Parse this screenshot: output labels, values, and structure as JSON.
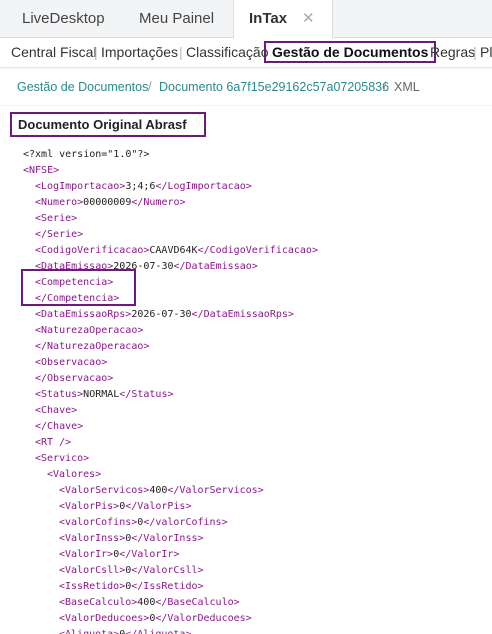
{
  "tabs": [
    {
      "label": "LiveDesktop"
    },
    {
      "label": "Meu Painel"
    },
    {
      "label": "InTax",
      "close": "✕"
    }
  ],
  "submenu": {
    "items": [
      "Central Fiscal",
      "Importações",
      "Classificação",
      "Gestão de Documentos",
      "Regras",
      "Pl"
    ],
    "separator": "|",
    "active_index": 3
  },
  "breadcrumb": {
    "items": [
      "Gestão de Documentos",
      "Documento 6a7f15e29162c57a07205836",
      "XML"
    ],
    "separator": "/"
  },
  "document": {
    "title": "Documento Original Abrasf",
    "xml_lines": [
      {
        "indent": 0,
        "tag": "<?xml version=\"1.0\"?>",
        "text": "",
        "close": ""
      },
      {
        "indent": 0,
        "tag": "<NFSE>",
        "text": "",
        "close": ""
      },
      {
        "indent": 1,
        "tag": "<LogImportacao>",
        "text": "3;4;6",
        "close": "</LogImportacao>"
      },
      {
        "indent": 1,
        "tag": "<Numero>",
        "text": "00000009",
        "close": "</Numero>"
      },
      {
        "indent": 1,
        "tag": "<Serie>",
        "text": "",
        "close": ""
      },
      {
        "indent": 1,
        "tag": "</Serie>",
        "text": "",
        "close": ""
      },
      {
        "indent": 1,
        "tag": "<CodigoVerificacao>",
        "text": "CAAVD64K",
        "close": "</CodigoVerificacao>"
      },
      {
        "indent": 1,
        "tag": "<DataEmissao>",
        "text": "2026-07-30",
        "close": "</DataEmissao>"
      },
      {
        "indent": 1,
        "tag": "<Competencia>",
        "text": "",
        "close": ""
      },
      {
        "indent": 1,
        "tag": "</Competencia>",
        "text": "",
        "close": ""
      },
      {
        "indent": 1,
        "tag": "<DataEmissaoRps>",
        "text": "2026-07-30",
        "close": "</DataEmissaoRps>"
      },
      {
        "indent": 1,
        "tag": "<NaturezaOperacao>",
        "text": "",
        "close": ""
      },
      {
        "indent": 1,
        "tag": "</NaturezaOperacao>",
        "text": "",
        "close": ""
      },
      {
        "indent": 1,
        "tag": "<Observacao>",
        "text": "",
        "close": ""
      },
      {
        "indent": 1,
        "tag": "</Observacao>",
        "text": "",
        "close": ""
      },
      {
        "indent": 1,
        "tag": "<Status>",
        "text": "NORMAL",
        "close": "</Status>"
      },
      {
        "indent": 1,
        "tag": "<Chave>",
        "text": "",
        "close": ""
      },
      {
        "indent": 1,
        "tag": "</Chave>",
        "text": "",
        "close": ""
      },
      {
        "indent": 1,
        "tag": "<RT />",
        "text": "",
        "close": ""
      },
      {
        "indent": 1,
        "tag": "<Servico>",
        "text": "",
        "close": ""
      },
      {
        "indent": 2,
        "tag": "<Valores>",
        "text": "",
        "close": ""
      },
      {
        "indent": 3,
        "tag": "<ValorServicos>",
        "text": "400",
        "close": "</ValorServicos>"
      },
      {
        "indent": 3,
        "tag": "<ValorPis>",
        "text": "0",
        "close": "</ValorPis>"
      },
      {
        "indent": 3,
        "tag": "<valorCofins>",
        "text": "0",
        "close": "</valorCofins>"
      },
      {
        "indent": 3,
        "tag": "<ValorInss>",
        "text": "0",
        "close": "</ValorInss>"
      },
      {
        "indent": 3,
        "tag": "<ValorIr>",
        "text": "0",
        "close": "</ValorIr>"
      },
      {
        "indent": 3,
        "tag": "<ValorCsll>",
        "text": "0",
        "close": "</ValorCsll>"
      },
      {
        "indent": 3,
        "tag": "<IssRetido>",
        "text": "0",
        "close": "</IssRetido>"
      },
      {
        "indent": 3,
        "tag": "<BaseCalculo>",
        "text": "400",
        "close": "</BaseCalculo>"
      },
      {
        "indent": 3,
        "tag": "<ValorDeducoes>",
        "text": "0",
        "close": "</ValorDeducoes>"
      },
      {
        "indent": 3,
        "tag": "<Aliquota>",
        "text": "0",
        "close": "</Aliquota>"
      }
    ]
  },
  "colors": {
    "accent": "#6d1a7d",
    "tag": "#8a1a8a",
    "link": "#2a8a8a"
  }
}
